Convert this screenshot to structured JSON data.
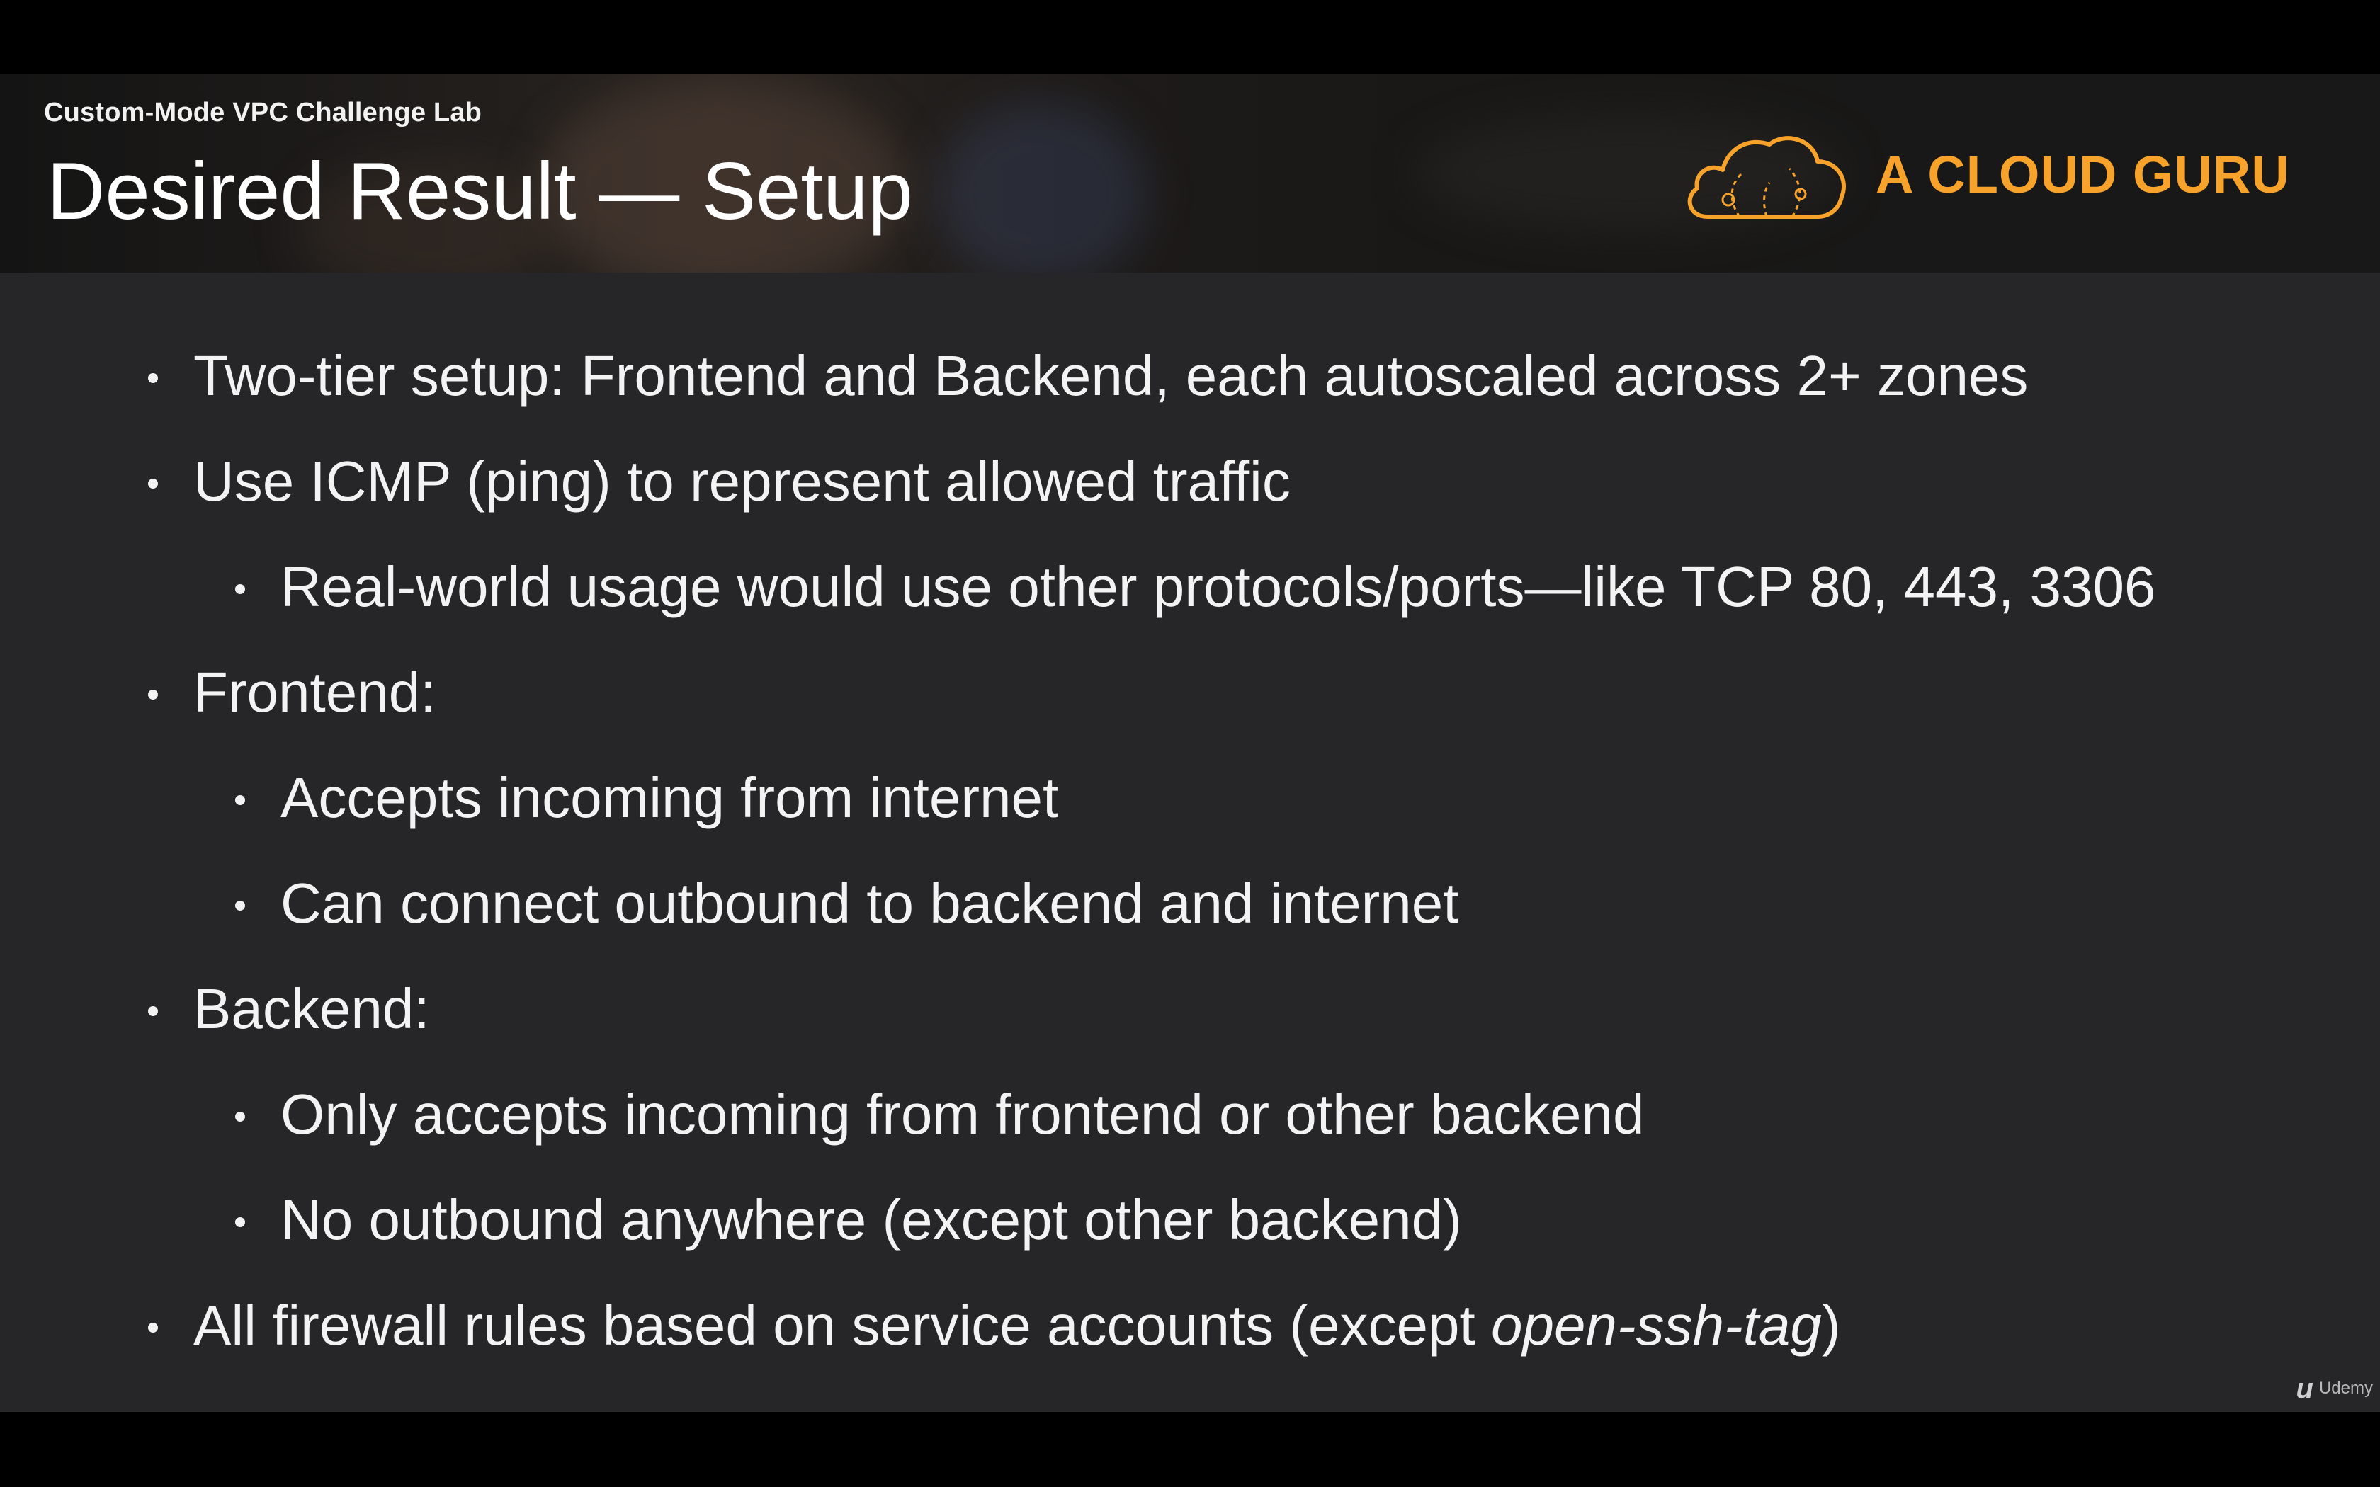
{
  "header": {
    "lab_title": "Custom-Mode VPC Challenge Lab",
    "slide_title": "Desired Result — Setup"
  },
  "brand": {
    "name": "A CLOUD GURU",
    "color": "#f6a22b",
    "icon": "cloud-logo-icon"
  },
  "bullets": [
    {
      "level": 1,
      "text": "Two-tier setup: Frontend and Backend, each autoscaled across 2+ zones"
    },
    {
      "level": 1,
      "text": "Use ICMP (ping) to represent allowed traffic"
    },
    {
      "level": 2,
      "text": "Real-world usage would use other protocols/ports—like TCP 80, 443, 3306"
    },
    {
      "level": 1,
      "text": "Frontend:"
    },
    {
      "level": 2,
      "text": "Accepts incoming from internet"
    },
    {
      "level": 2,
      "text": "Can connect outbound to backend and internet"
    },
    {
      "level": 1,
      "text": "Backend:"
    },
    {
      "level": 2,
      "text": "Only accepts incoming from frontend or other backend"
    },
    {
      "level": 2,
      "text": "No outbound anywhere (except other backend)"
    },
    {
      "level": 1,
      "text_prefix": "All firewall rules based on service accounts (except ",
      "text_italic": "open-ssh-tag",
      "text_suffix": ")"
    }
  ],
  "watermark": {
    "icon": "udemy-logo-icon",
    "label": "Udemy"
  }
}
